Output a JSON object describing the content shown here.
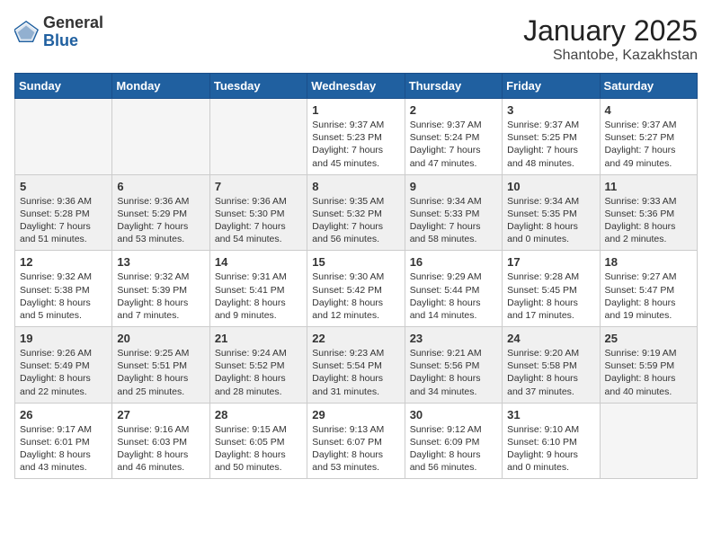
{
  "logo": {
    "general": "General",
    "blue": "Blue"
  },
  "title": "January 2025",
  "location": "Shantobe, Kazakhstan",
  "days_of_week": [
    "Sunday",
    "Monday",
    "Tuesday",
    "Wednesday",
    "Thursday",
    "Friday",
    "Saturday"
  ],
  "weeks": [
    [
      {
        "day": "",
        "info": ""
      },
      {
        "day": "",
        "info": ""
      },
      {
        "day": "",
        "info": ""
      },
      {
        "day": "1",
        "info": "Sunrise: 9:37 AM\nSunset: 5:23 PM\nDaylight: 7 hours and 45 minutes."
      },
      {
        "day": "2",
        "info": "Sunrise: 9:37 AM\nSunset: 5:24 PM\nDaylight: 7 hours and 47 minutes."
      },
      {
        "day": "3",
        "info": "Sunrise: 9:37 AM\nSunset: 5:25 PM\nDaylight: 7 hours and 48 minutes."
      },
      {
        "day": "4",
        "info": "Sunrise: 9:37 AM\nSunset: 5:27 PM\nDaylight: 7 hours and 49 minutes."
      }
    ],
    [
      {
        "day": "5",
        "info": "Sunrise: 9:36 AM\nSunset: 5:28 PM\nDaylight: 7 hours and 51 minutes."
      },
      {
        "day": "6",
        "info": "Sunrise: 9:36 AM\nSunset: 5:29 PM\nDaylight: 7 hours and 53 minutes."
      },
      {
        "day": "7",
        "info": "Sunrise: 9:36 AM\nSunset: 5:30 PM\nDaylight: 7 hours and 54 minutes."
      },
      {
        "day": "8",
        "info": "Sunrise: 9:35 AM\nSunset: 5:32 PM\nDaylight: 7 hours and 56 minutes."
      },
      {
        "day": "9",
        "info": "Sunrise: 9:34 AM\nSunset: 5:33 PM\nDaylight: 7 hours and 58 minutes."
      },
      {
        "day": "10",
        "info": "Sunrise: 9:34 AM\nSunset: 5:35 PM\nDaylight: 8 hours and 0 minutes."
      },
      {
        "day": "11",
        "info": "Sunrise: 9:33 AM\nSunset: 5:36 PM\nDaylight: 8 hours and 2 minutes."
      }
    ],
    [
      {
        "day": "12",
        "info": "Sunrise: 9:32 AM\nSunset: 5:38 PM\nDaylight: 8 hours and 5 minutes."
      },
      {
        "day": "13",
        "info": "Sunrise: 9:32 AM\nSunset: 5:39 PM\nDaylight: 8 hours and 7 minutes."
      },
      {
        "day": "14",
        "info": "Sunrise: 9:31 AM\nSunset: 5:41 PM\nDaylight: 8 hours and 9 minutes."
      },
      {
        "day": "15",
        "info": "Sunrise: 9:30 AM\nSunset: 5:42 PM\nDaylight: 8 hours and 12 minutes."
      },
      {
        "day": "16",
        "info": "Sunrise: 9:29 AM\nSunset: 5:44 PM\nDaylight: 8 hours and 14 minutes."
      },
      {
        "day": "17",
        "info": "Sunrise: 9:28 AM\nSunset: 5:45 PM\nDaylight: 8 hours and 17 minutes."
      },
      {
        "day": "18",
        "info": "Sunrise: 9:27 AM\nSunset: 5:47 PM\nDaylight: 8 hours and 19 minutes."
      }
    ],
    [
      {
        "day": "19",
        "info": "Sunrise: 9:26 AM\nSunset: 5:49 PM\nDaylight: 8 hours and 22 minutes."
      },
      {
        "day": "20",
        "info": "Sunrise: 9:25 AM\nSunset: 5:51 PM\nDaylight: 8 hours and 25 minutes."
      },
      {
        "day": "21",
        "info": "Sunrise: 9:24 AM\nSunset: 5:52 PM\nDaylight: 8 hours and 28 minutes."
      },
      {
        "day": "22",
        "info": "Sunrise: 9:23 AM\nSunset: 5:54 PM\nDaylight: 8 hours and 31 minutes."
      },
      {
        "day": "23",
        "info": "Sunrise: 9:21 AM\nSunset: 5:56 PM\nDaylight: 8 hours and 34 minutes."
      },
      {
        "day": "24",
        "info": "Sunrise: 9:20 AM\nSunset: 5:58 PM\nDaylight: 8 hours and 37 minutes."
      },
      {
        "day": "25",
        "info": "Sunrise: 9:19 AM\nSunset: 5:59 PM\nDaylight: 8 hours and 40 minutes."
      }
    ],
    [
      {
        "day": "26",
        "info": "Sunrise: 9:17 AM\nSunset: 6:01 PM\nDaylight: 8 hours and 43 minutes."
      },
      {
        "day": "27",
        "info": "Sunrise: 9:16 AM\nSunset: 6:03 PM\nDaylight: 8 hours and 46 minutes."
      },
      {
        "day": "28",
        "info": "Sunrise: 9:15 AM\nSunset: 6:05 PM\nDaylight: 8 hours and 50 minutes."
      },
      {
        "day": "29",
        "info": "Sunrise: 9:13 AM\nSunset: 6:07 PM\nDaylight: 8 hours and 53 minutes."
      },
      {
        "day": "30",
        "info": "Sunrise: 9:12 AM\nSunset: 6:09 PM\nDaylight: 8 hours and 56 minutes."
      },
      {
        "day": "31",
        "info": "Sunrise: 9:10 AM\nSunset: 6:10 PM\nDaylight: 9 hours and 0 minutes."
      },
      {
        "day": "",
        "info": ""
      }
    ]
  ]
}
